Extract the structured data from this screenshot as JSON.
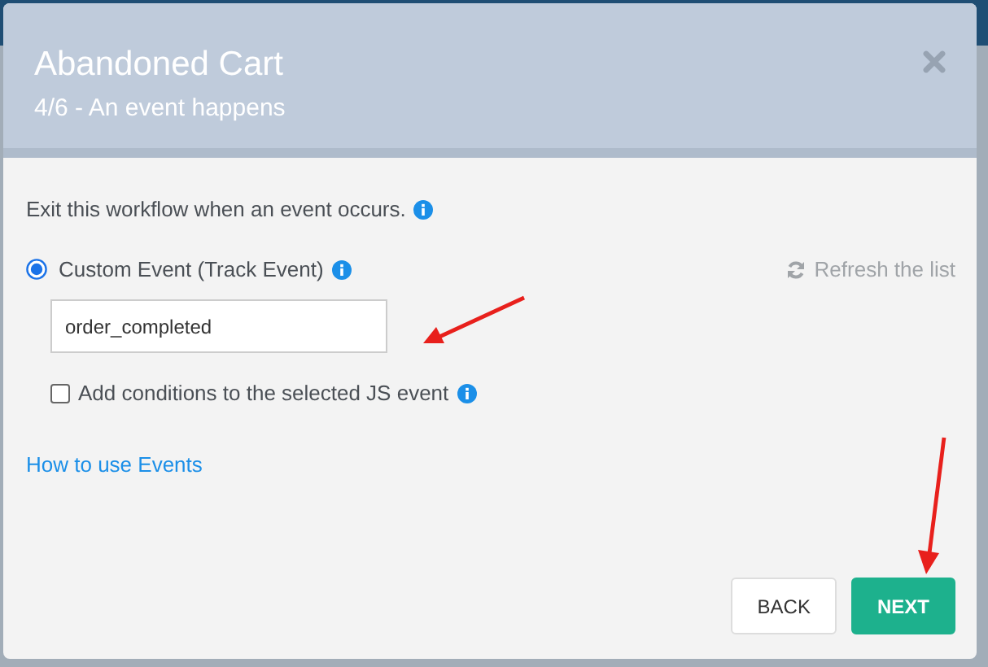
{
  "dialog": {
    "title": "Abandoned Cart",
    "subtitle": "4/6 - An event happens",
    "description": "Exit this workflow when an event occurs.",
    "options": [
      {
        "kind": "radio",
        "label": "Custom Event (Track Event)",
        "selected": true
      }
    ],
    "refresh_link": "Refresh the list",
    "event_field": {
      "value": "order_completed"
    },
    "conditions": {
      "label": "Add conditions to the selected JS event",
      "checked": false
    },
    "help_link": "How to use Events",
    "buttons": [
      {
        "label": "BACK",
        "kind": "secondary"
      },
      {
        "label": "NEXT",
        "kind": "primary"
      }
    ]
  }
}
